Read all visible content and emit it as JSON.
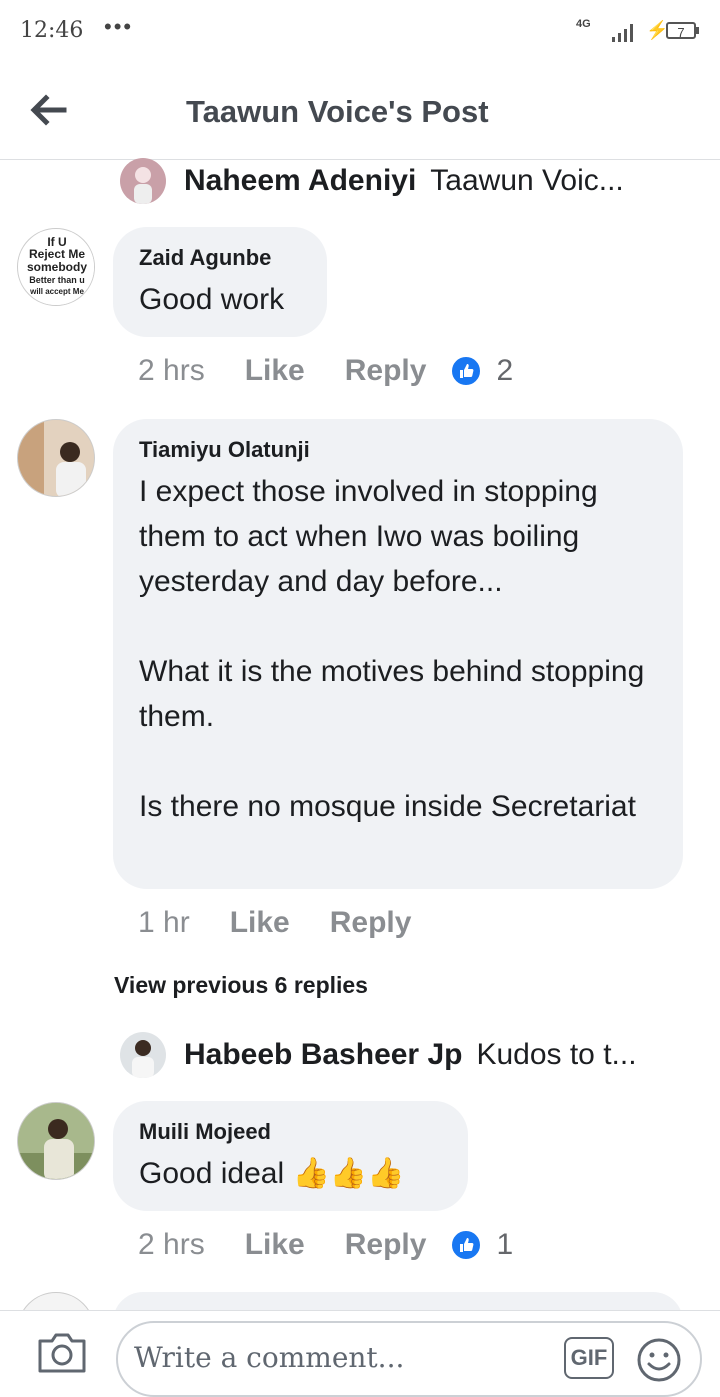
{
  "status_bar": {
    "time": "12:46",
    "dots": "•••",
    "network": "4G",
    "battery": "7"
  },
  "header": {
    "title": "Taawun Voice's Post"
  },
  "top_reply": {
    "name": "Naheem Adeniyi",
    "text": "Taawun Voic..."
  },
  "comments": [
    {
      "name": "Zaid Agunbe",
      "text": "Good work",
      "avatar_text": [
        "If U",
        "Reject Me",
        "somebody",
        "Better than u",
        "will accept Me"
      ],
      "time": "2 hrs",
      "like": "Like",
      "reply": "Reply",
      "reaction_count": "2"
    },
    {
      "name": "Tiamiyu Olatunji",
      "text": "I expect those involved in stopping them to act when Iwo was boiling yesterday and day before...\n\nWhat it is the motives behind stopping them.\n\nIs there no mosque inside Secretariat",
      "time": "1 hr",
      "like": "Like",
      "reply": "Reply"
    },
    {
      "name": "Muili Mojeed",
      "text": "Good ideal 👍👍👍",
      "time": "2 hrs",
      "like": "Like",
      "reply": "Reply",
      "reaction_count": "1"
    }
  ],
  "view_previous": "View previous 6 replies",
  "second_reply": {
    "name": "Habeeb Basheer Jp",
    "text": "Kudos to t..."
  },
  "composer": {
    "placeholder": "Write a comment...",
    "gif_label": "GIF"
  },
  "colors": {
    "bubble": "#f0f2f5",
    "reaction_blue": "#1877f2",
    "muted": "#8a8d91"
  }
}
